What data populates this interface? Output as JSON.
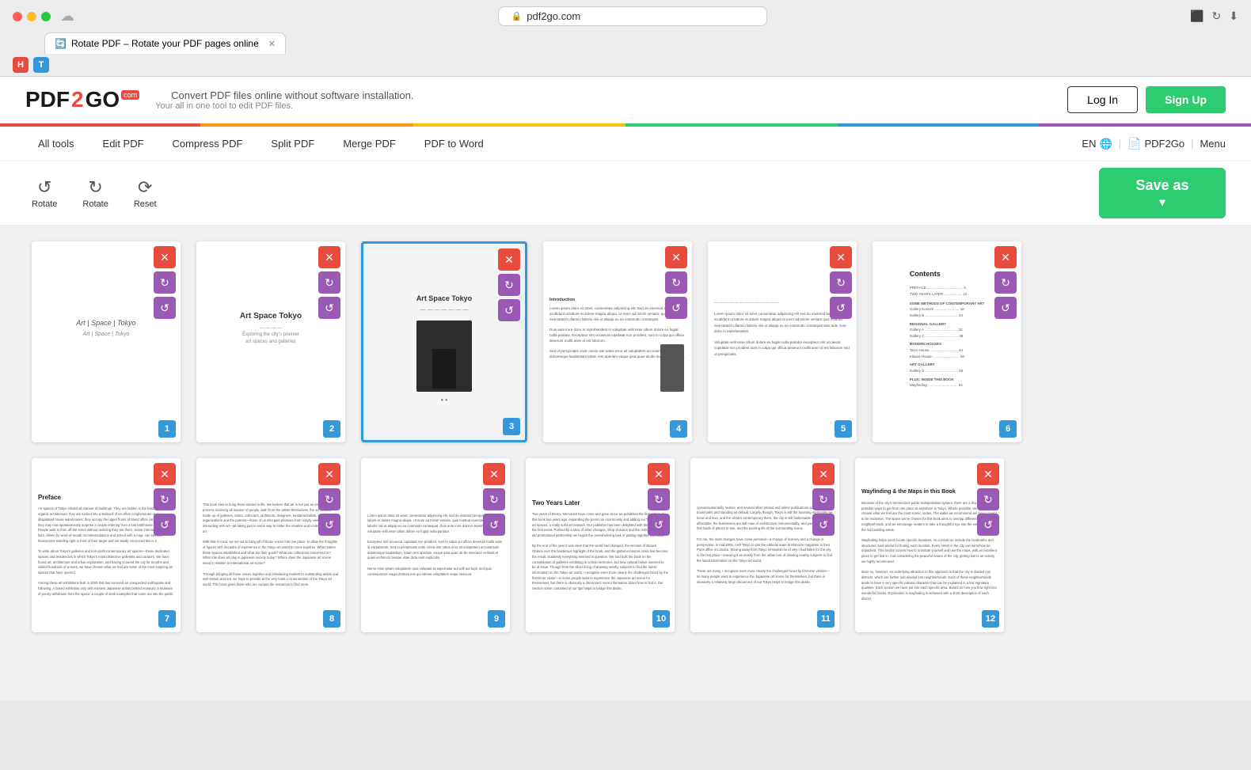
{
  "browser": {
    "url": "pdf2go.com",
    "tab_title": "Rotate PDF – Rotate your PDF pages online",
    "tab_favicon": "🔄",
    "controls": [
      "close",
      "minimize",
      "maximize"
    ]
  },
  "header": {
    "logo_pdf": "PDF",
    "logo_2": "2",
    "logo_go": "GO",
    "logo_badge": "com",
    "tagline_main": "Convert PDF files online without software installation.",
    "tagline_sub": "Your all in one tool to edit PDF files.",
    "btn_login": "Log In",
    "btn_signup": "Sign Up"
  },
  "nav": {
    "all_tools": "All tools",
    "edit_pdf": "Edit PDF",
    "compress_pdf": "Compress PDF",
    "split_pdf": "Split PDF",
    "merge_pdf": "Merge PDF",
    "pdf_to_word": "PDF to Word",
    "lang": "EN",
    "pdf2go_label": "PDF2Go",
    "menu": "Menu"
  },
  "toolbar": {
    "rotate_left_label": "Rotate",
    "rotate_right_label": "Rotate",
    "reset_label": "Reset",
    "save_as_label": "Save as",
    "save_as_chevron": "▾"
  },
  "pages_row1": [
    {
      "number": "1",
      "type": "cover",
      "title": "Art | Space | Tokyo",
      "subtitle": ""
    },
    {
      "number": "2",
      "type": "cover2",
      "title": "Art Space Tokyo",
      "subtitle": ""
    },
    {
      "number": "3",
      "type": "image-page",
      "title": "Art Space Tokyo",
      "subtitle": ""
    },
    {
      "number": "4",
      "type": "text",
      "title": ""
    },
    {
      "number": "5",
      "type": "blank-text",
      "title": ""
    },
    {
      "number": "6",
      "type": "toc",
      "title": "Contents"
    }
  ],
  "pages_row2": [
    {
      "number": "7",
      "type": "text",
      "chapter": "Preface"
    },
    {
      "number": "8",
      "type": "text-dense",
      "chapter": ""
    },
    {
      "number": "9",
      "type": "text-dense",
      "chapter": ""
    },
    {
      "number": "10",
      "type": "text-dense",
      "chapter": "Two Years Later"
    },
    {
      "number": "11",
      "type": "text-dense",
      "chapter": ""
    },
    {
      "number": "12",
      "type": "text-dense",
      "chapter": "Wayfinding & the Maps in this Book"
    }
  ],
  "highlighted_page": 3,
  "colors": {
    "red_close": "#ff5f57",
    "yellow_min": "#ffbd2e",
    "green_max": "#28c840",
    "accent_green": "#2ecc71",
    "accent_blue": "#3498db",
    "accent_red": "#e74c3c",
    "accent_purple": "#9b59b6"
  }
}
